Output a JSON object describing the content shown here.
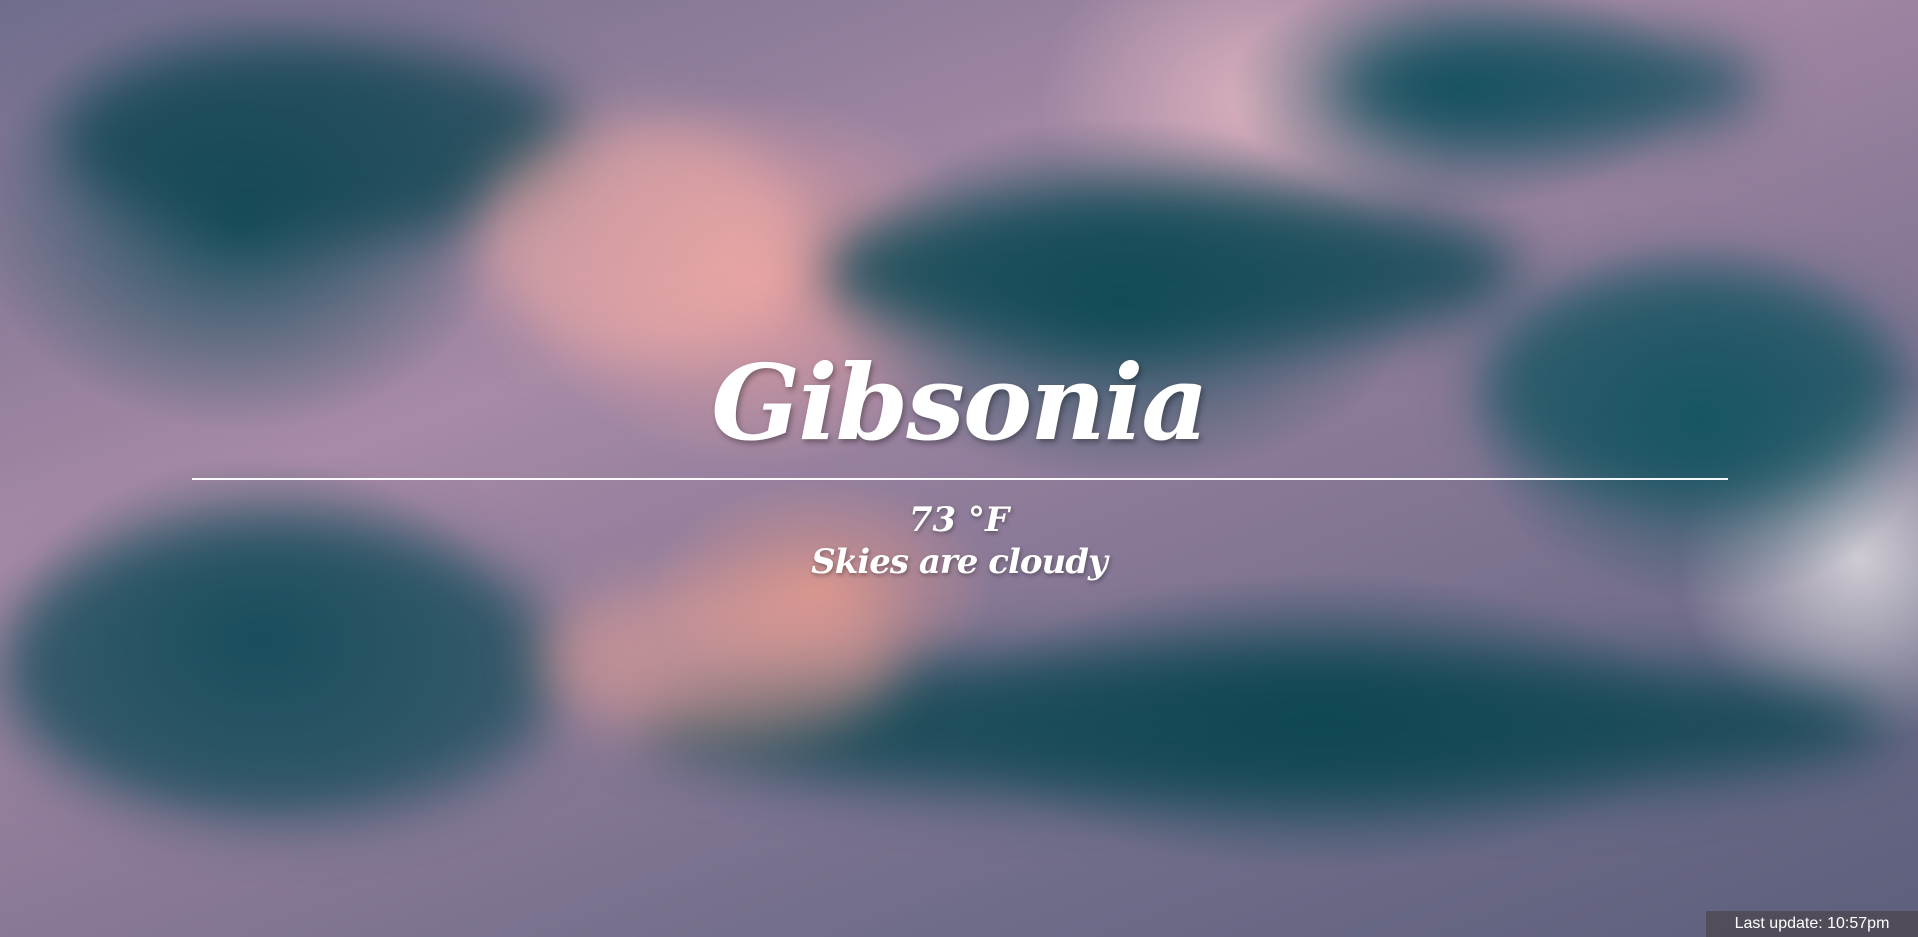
{
  "weather": {
    "city": "Gibsonia",
    "temperature": "73 °F",
    "description": "Skies are cloudy"
  },
  "footer": {
    "last_update": "Last update: 10:57pm"
  }
}
